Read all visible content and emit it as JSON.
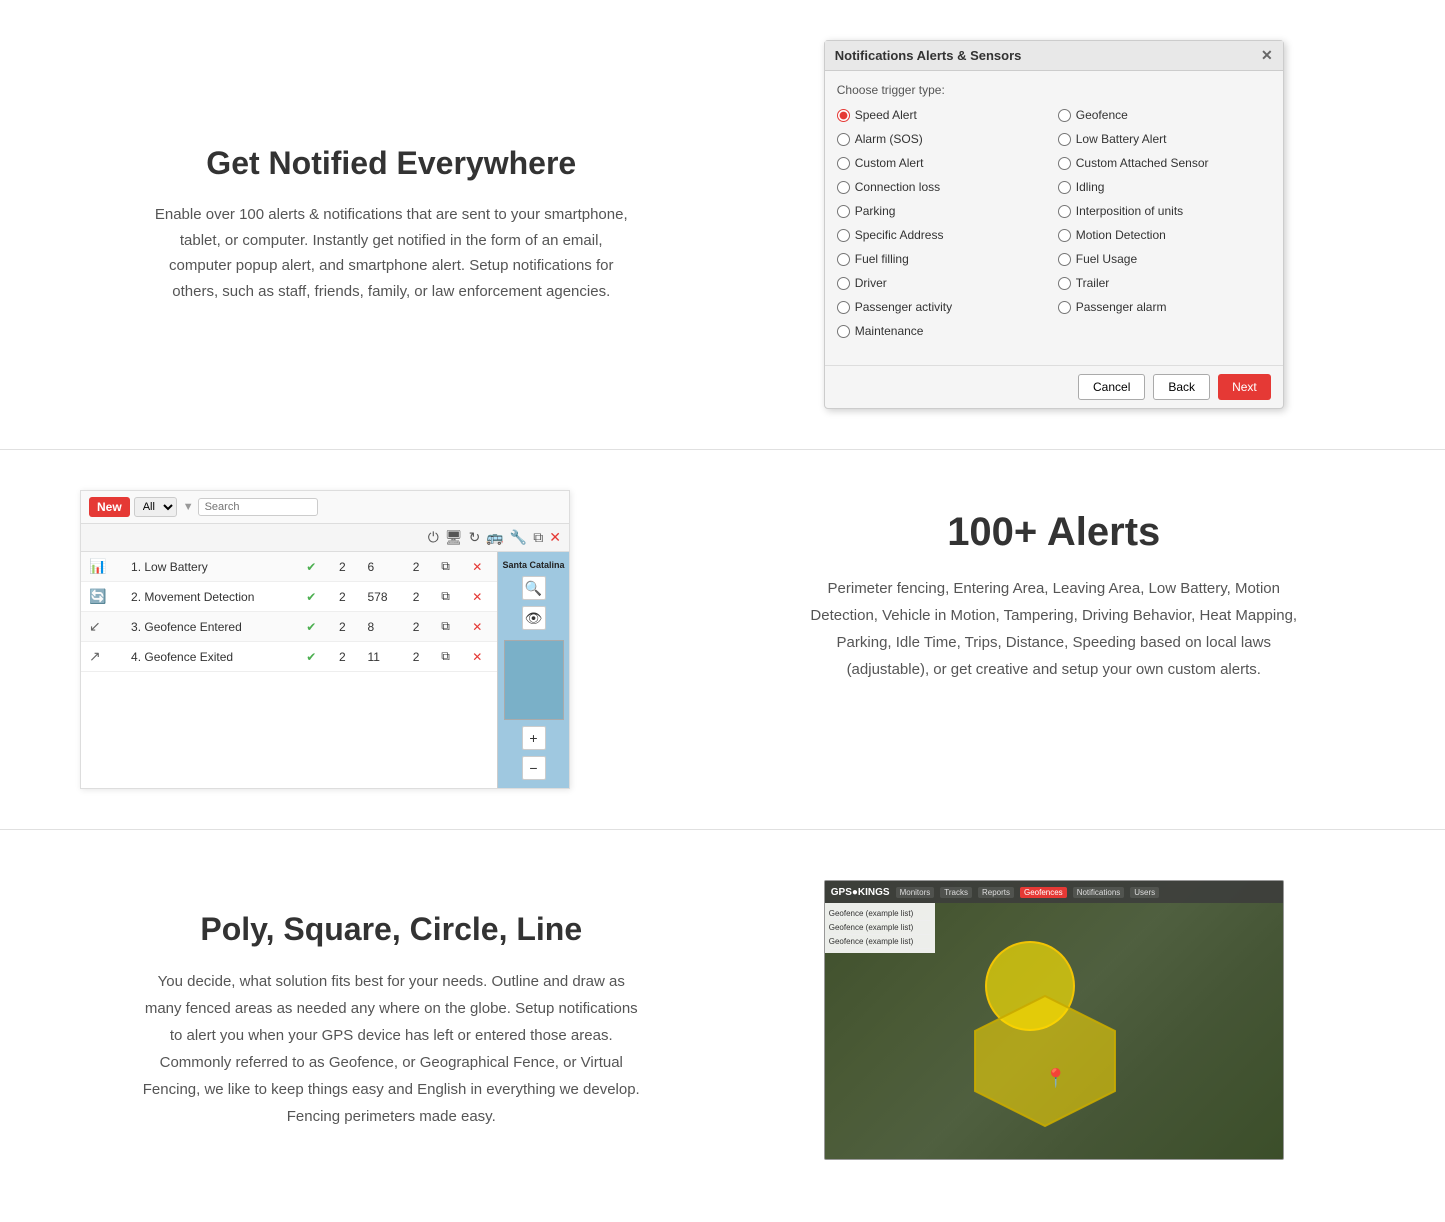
{
  "section1": {
    "heading": "Get Notified Everywhere",
    "description": "Enable over 100 alerts & notifications that are sent to your smartphone, tablet, or computer. Instantly get notified in the form of an email, computer popup alert, and smartphone alert. Setup notifications for others, such as staff, friends, family, or law enforcement agencies.",
    "modal": {
      "title": "Notifications Alerts & Sensors",
      "trigger_label": "Choose trigger type:",
      "options_left": [
        {
          "label": "Speed Alert",
          "checked": true
        },
        {
          "label": "Alarm (SOS)",
          "checked": false
        },
        {
          "label": "Custom Alert",
          "checked": false
        },
        {
          "label": "Connection loss",
          "checked": false
        },
        {
          "label": "Parking",
          "checked": false
        },
        {
          "label": "Specific Address",
          "checked": false
        },
        {
          "label": "Fuel filling",
          "checked": false
        },
        {
          "label": "Driver",
          "checked": false
        },
        {
          "label": "Passenger activity",
          "checked": false
        },
        {
          "label": "Maintenance",
          "checked": false
        }
      ],
      "options_right": [
        {
          "label": "Geofence",
          "checked": false
        },
        {
          "label": "Low Battery Alert",
          "checked": false
        },
        {
          "label": "Custom Attached Sensor",
          "checked": false
        },
        {
          "label": "Idling",
          "checked": false
        },
        {
          "label": "Interposition of units",
          "checked": false
        },
        {
          "label": "Motion Detection",
          "checked": false
        },
        {
          "label": "Fuel Usage",
          "checked": false
        },
        {
          "label": "Trailer",
          "checked": false
        },
        {
          "label": "Passenger alarm",
          "checked": false
        }
      ],
      "btn_cancel": "Cancel",
      "btn_back": "Back",
      "btn_next": "Next"
    }
  },
  "section2": {
    "heading": "100+ Alerts",
    "description": "Perimeter fencing, Entering Area, Leaving Area, Low Battery, Motion Detection, Vehicle in Motion, Tampering, Driving Behavior, Heat Mapping, Parking, Idle Time, Trips, Distance, Speeding based on local laws (adjustable), or get creative and setup your own custom alerts.",
    "panel": {
      "btn_new": "New",
      "select_filter": "All",
      "search_placeholder": "Search",
      "alerts": [
        {
          "num": "1.",
          "name": "Low Battery",
          "check": true,
          "val1": "2",
          "val2": "6",
          "val3": "2"
        },
        {
          "num": "2.",
          "name": "Movement Detection",
          "check": true,
          "val1": "2",
          "val2": "578",
          "val3": "2"
        },
        {
          "num": "3.",
          "name": "Geofence Entered",
          "check": true,
          "val1": "2",
          "val2": "8",
          "val3": "2"
        },
        {
          "num": "4.",
          "name": "Geofence Exited",
          "check": true,
          "val1": "2",
          "val2": "11",
          "val3": "2"
        }
      ],
      "map_label": "Santa Catalina Island"
    }
  },
  "section3": {
    "heading": "Poly, Square, Circle, Line",
    "description": "You decide, what solution fits best for your needs. Outline and draw as many fenced areas as needed any where on the globe. Setup notifications to alert you when your GPS device has left or entered those areas. Commonly referred to as Geofence, or Geographical Fence, or Virtual Fencing, we like to keep things easy and English in everything we develop. Fencing perimeters made easy.",
    "map": {
      "toolbar_items": [
        "Monitors",
        "Tracks",
        "Reports",
        "Geofences",
        "Notifications",
        "Users"
      ],
      "active_tab": "Geofences",
      "sidebar_items": [
        "Geofence (example list)",
        "Geofence (example list)",
        "Geofence (example list)"
      ]
    }
  }
}
